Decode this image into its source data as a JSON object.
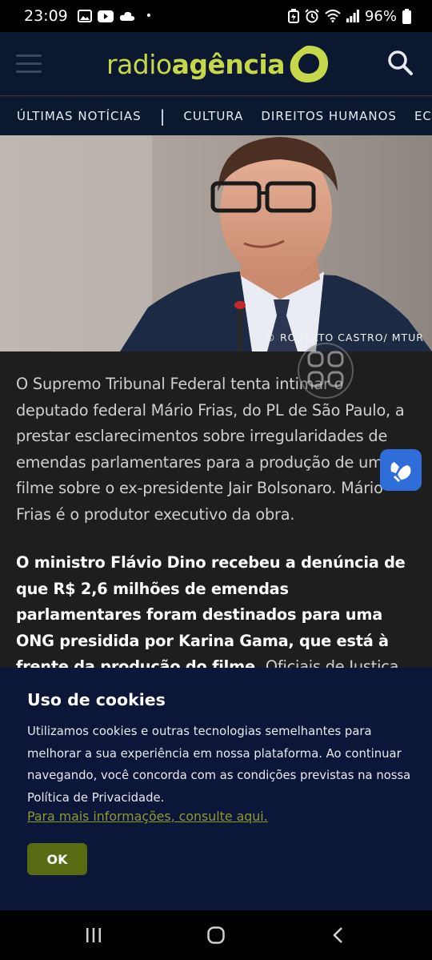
{
  "status_bar": {
    "time": "23:09",
    "dot": "•",
    "battery_percent": "96%",
    "icons_left": [
      "image-icon",
      "youtube-icon",
      "cloud-icon"
    ],
    "icons_right": [
      "battery-saver-icon",
      "alarm-icon",
      "wifi-icon",
      "signal-icon",
      "battery-icon"
    ]
  },
  "header": {
    "logo_light": "radio",
    "logo_bold": "agência",
    "accent_color": "#c6d84a",
    "background_color": "#0c1730"
  },
  "nav": {
    "items": [
      "ÚLTIMAS NOTÍCIAS",
      "CULTURA",
      "DIREITOS HUMANOS",
      "ECO"
    ],
    "separator": "|"
  },
  "hero": {
    "credit": "© ROBERTO CASTRO/ MTUR"
  },
  "article": {
    "paragraph1": "O Supremo Tribunal Federal tenta intimar o deputado federal Mário Frias, do PL de São Paulo, a prestar esclarecimentos sobre irregularidades de emendas parlamentares para a produção de um filme sobre o ex-presidente Jair Bolsonaro. Mário Frias é o produtor executivo da obra.",
    "paragraph2_bold": "O ministro Flávio Dino recebeu a denúncia de que R$ 2,6 milhões de emendas parlamentares foram destinados para uma ONG presidida por Karina Gama, que está à frente da produção do filme.",
    "paragraph2_rest": " Oficiais de Justiça tentaram notificar o deputado"
  },
  "cookie_banner": {
    "title": "Uso de cookies",
    "text": "Utilizamos cookies e outras tecnologias semelhantes para melhorar a sua experiência em nossa plataforma. Ao continuar navegando, você concorda com as condições previstas na nossa Política de Privacidade.",
    "link": "Para mais informações, consulte aqui.",
    "ok_label": "OK",
    "link_color": "#8f9a2c",
    "button_color": "#586a12"
  },
  "system_nav": {
    "buttons": [
      "recent-apps-icon",
      "home-icon",
      "back-icon"
    ]
  }
}
